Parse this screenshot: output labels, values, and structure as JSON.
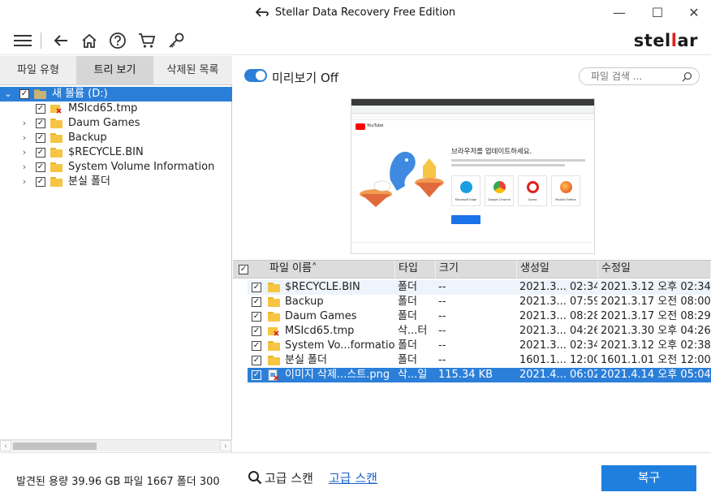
{
  "window": {
    "title": "Stellar Data Recovery Free Edition",
    "min_glyph": "—",
    "max_glyph": "☐",
    "close_glyph": "✕"
  },
  "toolbar": {
    "logo_left": "stel",
    "logo_mark": "l",
    "logo_right": "ar",
    "icons": [
      "menu-icon",
      "back-arrow-icon",
      "home-icon",
      "help-icon",
      "cart-icon",
      "key-icon"
    ]
  },
  "left_tabs": [
    "파일 유형",
    "트리 보기",
    "삭제된 목록"
  ],
  "tree": {
    "root": "새 볼륨 (D:)",
    "items": [
      {
        "label": "MSIcd65.tmp",
        "type": "deleted-file",
        "expandable": false
      },
      {
        "label": "Daum Games",
        "type": "folder",
        "expandable": true
      },
      {
        "label": "Backup",
        "type": "folder",
        "expandable": true
      },
      {
        "label": "$RECYCLE.BIN",
        "type": "folder",
        "expandable": true
      },
      {
        "label": "System Volume Information",
        "type": "folder",
        "expandable": true
      },
      {
        "label": "분실 폴더",
        "type": "folder",
        "expandable": true
      }
    ]
  },
  "preview": {
    "toggle_label": "미리보기 Off",
    "search_placeholder": "파일 검색 ...",
    "thumb_headline": "브라우저를 업데이트하세요.",
    "thumb_brand": "YouTube",
    "thumb_browsers": [
      "Microsoft Edge",
      "Google Chrome",
      "Opera",
      "Mozilla Firefox"
    ]
  },
  "table": {
    "columns": [
      "파일 이름",
      "타입",
      "크기",
      "생성일",
      "수정일"
    ],
    "sort_indicator": "˄",
    "rows": [
      {
        "name": "$RECYCLE.BIN",
        "type": "폴더",
        "size": "--",
        "created": "2021.3... 02:34",
        "modified": "2021.3.12 오후 02:34",
        "icon": "folder"
      },
      {
        "name": "Backup",
        "type": "폴더",
        "size": "--",
        "created": "2021.3... 07:59",
        "modified": "2021.3.17 오전 08:00",
        "icon": "folder"
      },
      {
        "name": "Daum Games",
        "type": "폴더",
        "size": "--",
        "created": "2021.3... 08:28",
        "modified": "2021.3.17 오전 08:29",
        "icon": "folder"
      },
      {
        "name": "MSIcd65.tmp",
        "type": "삭...터",
        "size": "--",
        "created": "2021.3... 04:26",
        "modified": "2021.3.30 오후 04:26",
        "icon": "deleted-folder"
      },
      {
        "name": "System Vo...formation",
        "type": "폴더",
        "size": "--",
        "created": "2021.3... 02:34",
        "modified": "2021.3.12 오후 02:38",
        "icon": "folder"
      },
      {
        "name": "분실 폴더",
        "type": "폴더",
        "size": "--",
        "created": "1601.1... 12:00",
        "modified": "1601.1.01 오전 12:00",
        "icon": "folder"
      },
      {
        "name": "이미지 삭제...스트.png",
        "type": "삭...일",
        "size": "115.34 KB",
        "created": "2021.4... 06:02",
        "modified": "2021.4.14 오후 05:04",
        "icon": "image-file"
      }
    ]
  },
  "status": {
    "found": "발견된 용량 39.96 GB 파일  1667  폴더 300",
    "advanced_scan_label": "고급 스캔",
    "advanced_scan_link": "고급 스캔",
    "recover_button": "복구"
  },
  "colors": {
    "accent": "#2b7fd8",
    "recover_button": "#1f7fde",
    "folder": "#f6c544",
    "logo_mark": "#e0201b"
  }
}
